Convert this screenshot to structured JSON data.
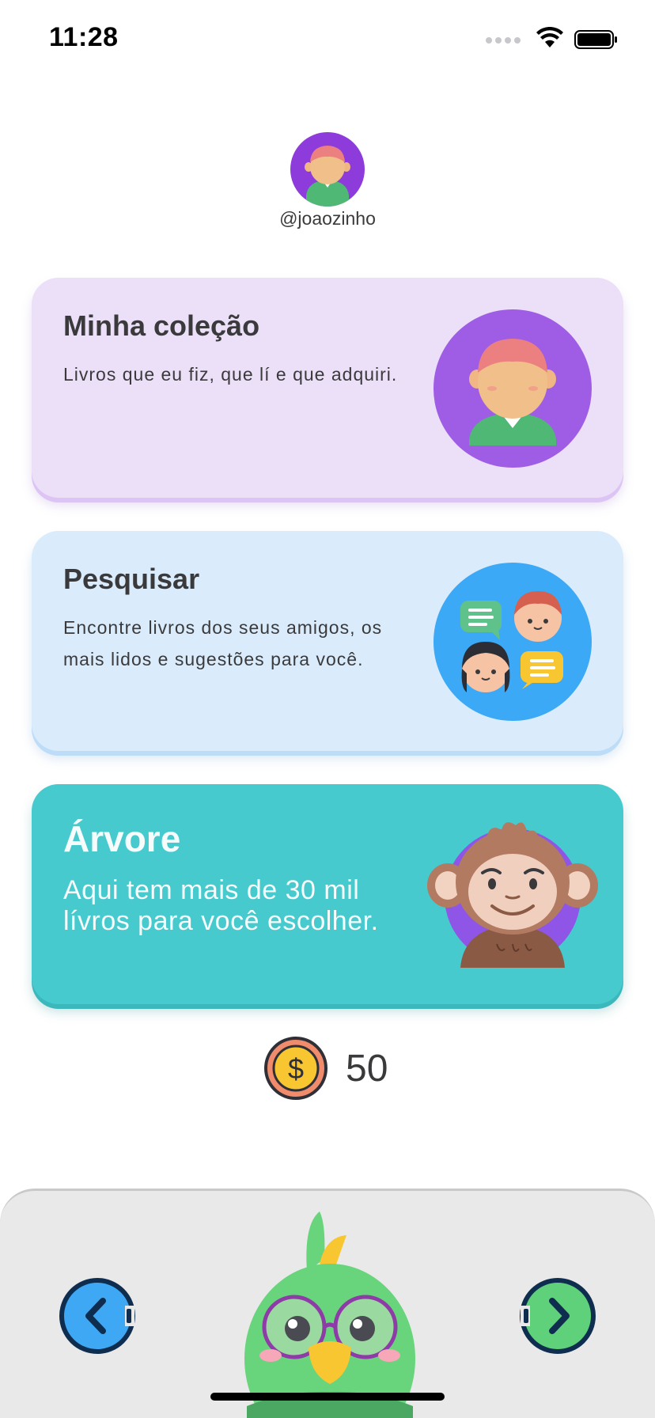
{
  "status_bar": {
    "time": "11:28"
  },
  "profile": {
    "username": "@joaozinho"
  },
  "cards": {
    "collection": {
      "title": "Minha coleção",
      "description": "Livros que eu fiz, que lí e que adquiri."
    },
    "search": {
      "title": "Pesquisar",
      "description": "Encontre livros dos seus amigos, os mais lidos e sugestões para você."
    },
    "tree": {
      "title": "Árvore",
      "description": "Aqui tem mais de 30 mil lívros para você escolher."
    }
  },
  "coins": {
    "value": "50",
    "icon": "dollar-coin-icon"
  },
  "colors": {
    "collection_card": "#ecdff8",
    "search_card": "#daecfb",
    "tree_card": "#46cace",
    "avatar_bg": "#8e3bdb",
    "prev_button": "#3ea8f5",
    "next_button": "#5fd17a"
  }
}
